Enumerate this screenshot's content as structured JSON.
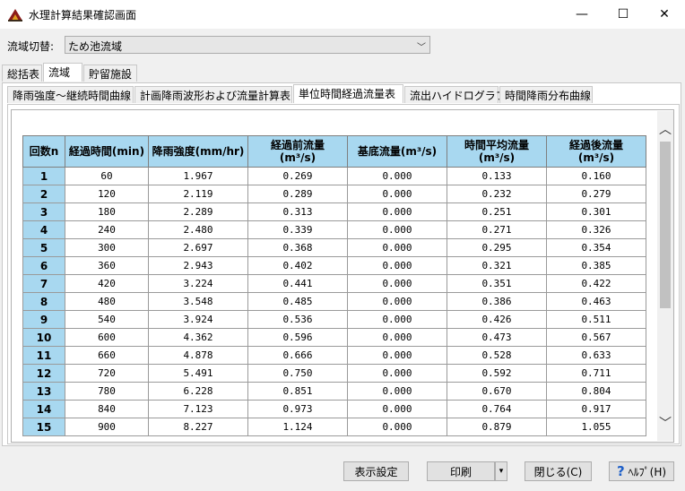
{
  "window": {
    "title": "水理計算結果確認画面",
    "minimize": "—",
    "maximize": "☐",
    "close": "✕"
  },
  "region": {
    "label": "流域切替:",
    "selected": "ため池流域"
  },
  "top_tabs": [
    {
      "label": "総括表",
      "selected": false
    },
    {
      "label": "流域",
      "selected": true
    },
    {
      "label": "貯留施設",
      "selected": false
    }
  ],
  "sub_tabs": [
    {
      "label": "降雨強度～継続時間曲線",
      "selected": false
    },
    {
      "label": "計画降雨波形および流量計算表",
      "selected": false
    },
    {
      "label": "単位時間経過流量表",
      "selected": true
    },
    {
      "label": "流出ハイドログラフ",
      "selected": false
    },
    {
      "label": "時間降雨分布曲線",
      "selected": false
    }
  ],
  "table": {
    "headers": [
      {
        "line1": "回数n",
        "line2": ""
      },
      {
        "line1": "経過時間(min)",
        "line2": ""
      },
      {
        "line1": "降雨強度(mm/hr)",
        "line2": ""
      },
      {
        "line1": "経過前流量",
        "line2": "(m³/s)"
      },
      {
        "line1": "基底流量(m³/s)",
        "line2": ""
      },
      {
        "line1": "時間平均流量",
        "line2": "(m³/s)"
      },
      {
        "line1": "経過後流量",
        "line2": "(m³/s)"
      }
    ],
    "rows": [
      [
        "1",
        "60",
        "1.967",
        "0.269",
        "0.000",
        "0.133",
        "0.160"
      ],
      [
        "2",
        "120",
        "2.119",
        "0.289",
        "0.000",
        "0.232",
        "0.279"
      ],
      [
        "3",
        "180",
        "2.289",
        "0.313",
        "0.000",
        "0.251",
        "0.301"
      ],
      [
        "4",
        "240",
        "2.480",
        "0.339",
        "0.000",
        "0.271",
        "0.326"
      ],
      [
        "5",
        "300",
        "2.697",
        "0.368",
        "0.000",
        "0.295",
        "0.354"
      ],
      [
        "6",
        "360",
        "2.943",
        "0.402",
        "0.000",
        "0.321",
        "0.385"
      ],
      [
        "7",
        "420",
        "3.224",
        "0.441",
        "0.000",
        "0.351",
        "0.422"
      ],
      [
        "8",
        "480",
        "3.548",
        "0.485",
        "0.000",
        "0.386",
        "0.463"
      ],
      [
        "9",
        "540",
        "3.924",
        "0.536",
        "0.000",
        "0.426",
        "0.511"
      ],
      [
        "10",
        "600",
        "4.362",
        "0.596",
        "0.000",
        "0.473",
        "0.567"
      ],
      [
        "11",
        "660",
        "4.878",
        "0.666",
        "0.000",
        "0.528",
        "0.633"
      ],
      [
        "12",
        "720",
        "5.491",
        "0.750",
        "0.000",
        "0.592",
        "0.711"
      ],
      [
        "13",
        "780",
        "6.228",
        "0.851",
        "0.000",
        "0.670",
        "0.804"
      ],
      [
        "14",
        "840",
        "7.123",
        "0.973",
        "0.000",
        "0.764",
        "0.917"
      ],
      [
        "15",
        "900",
        "8.227",
        "1.124",
        "0.000",
        "0.879",
        "1.055"
      ]
    ]
  },
  "buttons": {
    "display_settings": "表示設定",
    "print": "印刷",
    "print_arrow": "▾",
    "close": "閉じる(C)",
    "help": "ﾍﾙﾌﾟ(H)",
    "help_icon": "?"
  },
  "scrollbar": {
    "up_icon": "︿",
    "down_icon": "﹀"
  }
}
